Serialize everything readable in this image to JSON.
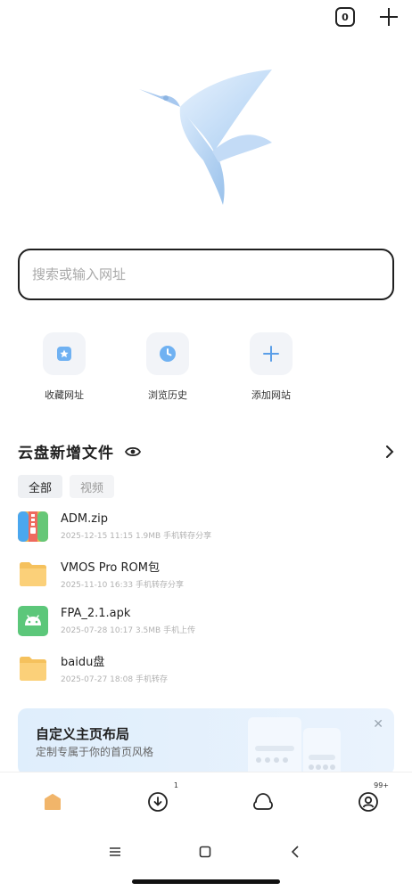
{
  "topbar": {
    "tab_count": "0"
  },
  "search": {
    "placeholder": "搜索或输入网址"
  },
  "shortcuts": [
    {
      "label": "收藏网址",
      "icon": "bookmark-star-icon"
    },
    {
      "label": "浏览历史",
      "icon": "clock-icon"
    },
    {
      "label": "添加网站",
      "icon": "plus-icon"
    }
  ],
  "cloud": {
    "title": "云盘新增文件",
    "filters": [
      "全部",
      "视频"
    ]
  },
  "files": [
    {
      "name": "ADM.zip",
      "meta": "2025-12-15 11:15  1.9MB  手机转存分享",
      "icon": "zip-icon"
    },
    {
      "name": "VMOS Pro  ROM包",
      "meta": "2025-11-10 16:33  手机转存分享",
      "icon": "folder-icon"
    },
    {
      "name": "FPA_2.1.apk",
      "meta": "2025-07-28 10:17  3.5MB  手机上传",
      "icon": "android-icon"
    },
    {
      "name": "baidu盘",
      "meta": "2025-07-27 18:08  手机转存",
      "icon": "folder-icon"
    }
  ],
  "banner": {
    "title": "自定义主页布局",
    "subtitle": "定制专属于你的首页风格",
    "close": "✕"
  },
  "navbar": {
    "download_badge": "1",
    "profile_badge": "99+"
  },
  "colors": {
    "accent": "#4a90e2",
    "folder": "#f7c56b",
    "android": "#5cc77a",
    "banner_bg": "#dfeefc"
  }
}
